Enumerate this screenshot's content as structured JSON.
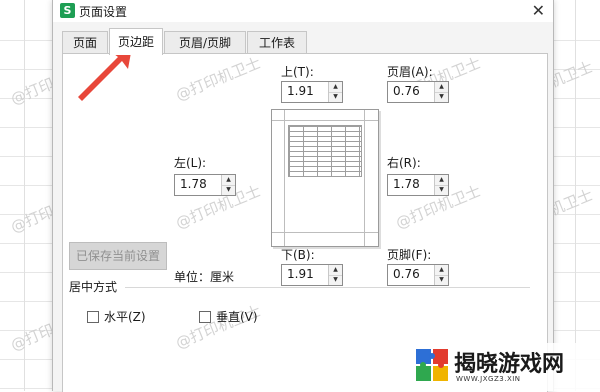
{
  "window": {
    "app_icon_letter": "S",
    "title": "页面设置"
  },
  "tabs": [
    {
      "label": "页面",
      "active": false
    },
    {
      "label": "页边距",
      "active": true
    },
    {
      "label": "页眉/页脚",
      "active": false
    },
    {
      "label": "工作表",
      "active": false
    }
  ],
  "margins": {
    "top": {
      "label": "上(T):",
      "value": "1.91"
    },
    "header": {
      "label": "页眉(A):",
      "value": "0.76"
    },
    "left": {
      "label": "左(L):",
      "value": "1.78"
    },
    "right": {
      "label": "右(R):",
      "value": "1.78"
    },
    "bottom": {
      "label": "下(B):",
      "value": "1.91"
    },
    "footer": {
      "label": "页脚(F):",
      "value": "0.76"
    }
  },
  "unit_label": "单位：厘米",
  "save_button": {
    "label": "已保存当前设置",
    "enabled": false
  },
  "center": {
    "title": "居中方式",
    "horizontal": {
      "label": "水平(Z)",
      "checked": false
    },
    "vertical": {
      "label": "垂直(V)",
      "checked": false
    }
  },
  "watermark_text": "@打印机卫士",
  "logo": {
    "name": "揭晓游戏网",
    "url": "WWW.JXGZ3.XIN"
  },
  "colors": {
    "app_icon": "#1e9e54",
    "arrow": "#e8473a",
    "logo_blue": "#2d6fd6",
    "logo_red": "#e23b2e",
    "logo_yellow": "#f0b400",
    "logo_green": "#2fa84f"
  }
}
